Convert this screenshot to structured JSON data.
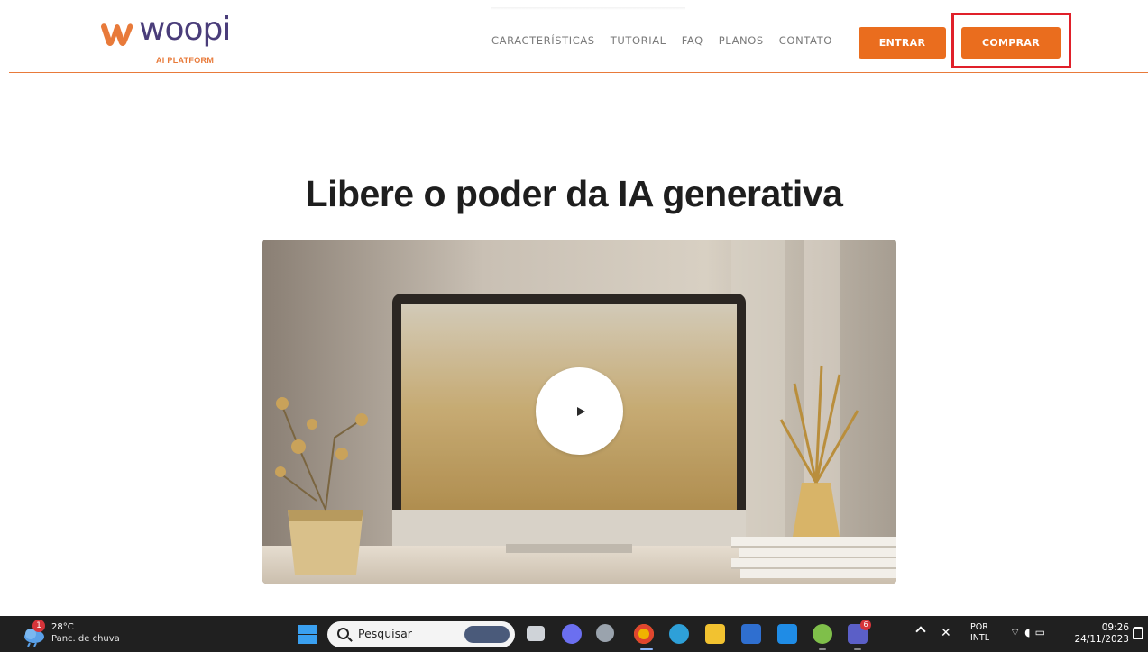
{
  "header": {
    "logo_word": "woopi",
    "logo_sub": "AI PLATFORM",
    "nav": [
      "CARACTERÍSTICAS",
      "TUTORIAL",
      "FAQ",
      "PLANOS",
      "CONTATO"
    ],
    "entrar_label": "ENTRAR",
    "comprar_label": "COMPRAR",
    "highlighted_element": "comprar-button"
  },
  "hero": {
    "title": "Libere o poder da IA generativa",
    "video_state": "paused"
  },
  "taskbar": {
    "weather_badge": "1",
    "weather_temp": "28°C",
    "weather_desc": "Panc. de chuva",
    "search_placeholder": "Pesquisar",
    "teams_badge": "6",
    "lang_line1": "POR",
    "lang_line2": "INTL",
    "time": "09:26",
    "date": "24/11/2023"
  },
  "colors": {
    "accent_orange": "#ea6d1e",
    "highlight_red": "#e0202a",
    "logo_purple": "#4a3d7a"
  }
}
